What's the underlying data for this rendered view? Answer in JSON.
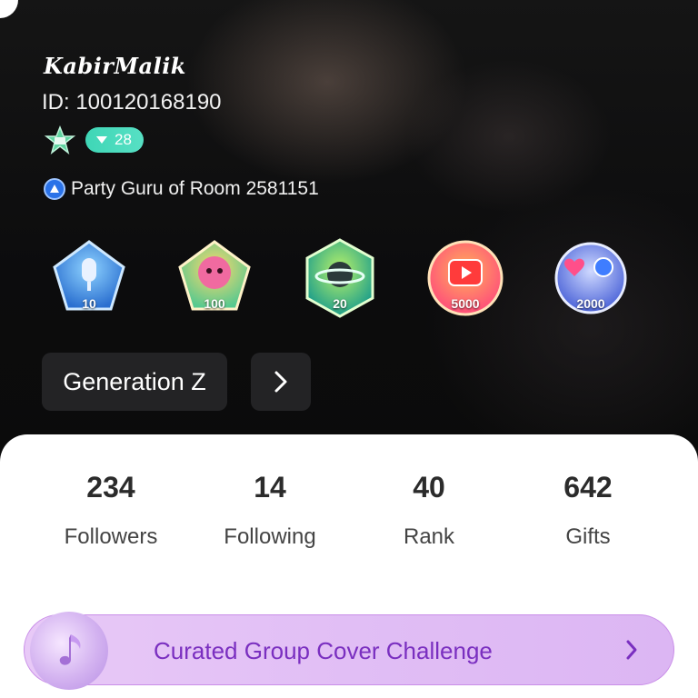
{
  "profile": {
    "username": "KabirMalik",
    "user_id": "ID: 100120168190",
    "level": "28",
    "title": "Party Guru of Room 2581151"
  },
  "medals": [
    {
      "icon": "microphone-medal-icon",
      "count": "10",
      "color": "#3a8fe0"
    },
    {
      "icon": "monkey-medal-icon",
      "count": "100",
      "color": "#e9669a"
    },
    {
      "icon": "planet-medal-icon",
      "count": "20",
      "color": "#2fb87a"
    },
    {
      "icon": "video-medal-icon",
      "count": "5000",
      "color": "#ff6a3a"
    },
    {
      "icon": "heart-medal-icon",
      "count": "2000",
      "color": "#5a7fe6"
    }
  ],
  "generation": {
    "label": "Generation Z"
  },
  "stats": [
    {
      "value": "234",
      "label": "Followers"
    },
    {
      "value": "14",
      "label": "Following"
    },
    {
      "value": "40",
      "label": "Rank"
    },
    {
      "value": "642",
      "label": "Gifts"
    }
  ],
  "challenge": {
    "label": "Curated Group Cover Challenge"
  },
  "colors": {
    "accent_teal": "#3fd6b6",
    "challenge_purple": "#7a2fc0",
    "panel_bg": "#ffffff"
  }
}
